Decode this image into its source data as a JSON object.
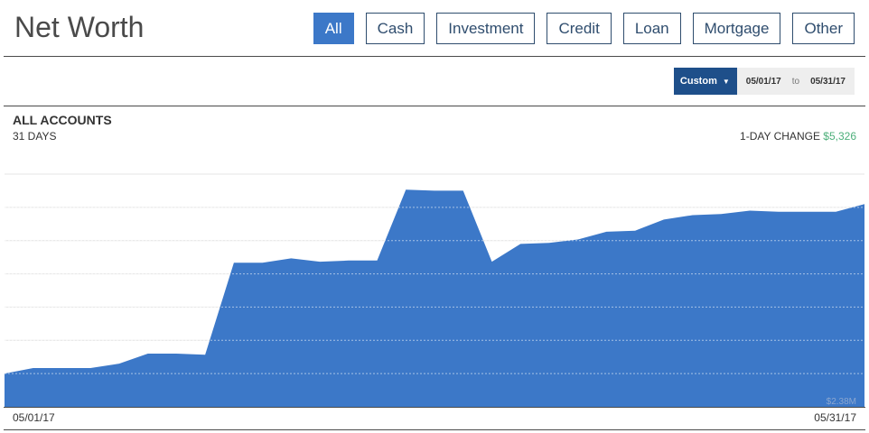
{
  "header": {
    "title": "Net Worth",
    "filters": [
      "All",
      "Cash",
      "Investment",
      "Credit",
      "Loan",
      "Mortgage",
      "Other"
    ],
    "active_filter": "All"
  },
  "date_range": {
    "mode": "Custom",
    "from": "05/01/17",
    "sep": "to",
    "to": "05/31/17"
  },
  "summary": {
    "title": "ALL ACCOUNTS",
    "days": "31 DAYS",
    "change_label": "1-DAY CHANGE",
    "change_value": "$5,326"
  },
  "colors": {
    "area": "#3c78c8",
    "accent": "#1e4f8a",
    "positive": "#4caf7a"
  },
  "chart_data": {
    "type": "area",
    "x_start": "05/01/17",
    "x_end": "05/31/17",
    "ymin_label": "$2.38M",
    "grid": true,
    "x": [
      "05/01/17",
      "05/02/17",
      "05/03/17",
      "05/04/17",
      "05/05/17",
      "05/06/17",
      "05/07/17",
      "05/08/17",
      "05/09/17",
      "05/10/17",
      "05/11/17",
      "05/12/17",
      "05/13/17",
      "05/14/17",
      "05/15/17",
      "05/16/17",
      "05/17/17",
      "05/18/17",
      "05/19/17",
      "05/20/17",
      "05/21/17",
      "05/22/17",
      "05/23/17",
      "05/24/17",
      "05/25/17",
      "05/26/17",
      "05/27/17",
      "05/28/17",
      "05/29/17",
      "05/30/17",
      "05/31/17"
    ],
    "values": [
      2.41,
      2.415,
      2.415,
      2.415,
      2.419,
      2.428,
      2.428,
      2.427,
      2.51,
      2.51,
      2.514,
      2.511,
      2.512,
      2.512,
      2.576,
      2.575,
      2.575,
      2.511,
      2.527,
      2.528,
      2.531,
      2.538,
      2.539,
      2.549,
      2.553,
      2.554,
      2.557,
      2.556,
      2.556,
      2.556,
      2.563
    ]
  }
}
